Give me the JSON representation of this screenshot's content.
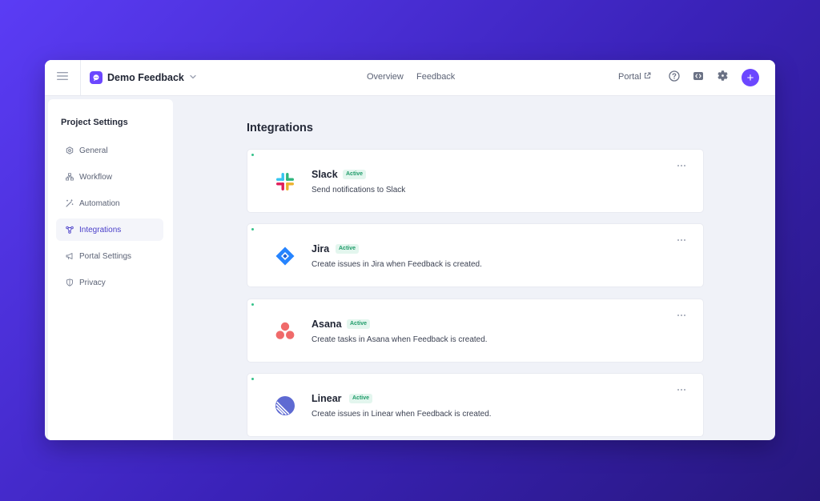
{
  "header": {
    "project_name": "Demo Feedback",
    "nav": [
      {
        "label": "Overview"
      },
      {
        "label": "Feedback"
      }
    ],
    "portal_label": "Portal",
    "icons": [
      "menu-icon",
      "chevron-down-icon",
      "external-link-icon",
      "help-icon",
      "code-icon",
      "gear-icon",
      "plus-icon"
    ],
    "plus_label": "+"
  },
  "sidebar": {
    "title": "Project Settings",
    "items": [
      {
        "label": "General",
        "icon": "settings-hex-icon"
      },
      {
        "label": "Workflow",
        "icon": "workflow-icon"
      },
      {
        "label": "Automation",
        "icon": "wand-icon"
      },
      {
        "label": "Integrations",
        "icon": "integrations-icon",
        "active": true
      },
      {
        "label": "Portal Settings",
        "icon": "megaphone-icon"
      },
      {
        "label": "Privacy",
        "icon": "shield-icon"
      }
    ]
  },
  "main": {
    "title": "Integrations",
    "integrations": [
      {
        "name": "Slack",
        "status": "Active",
        "description": "Send notifications to Slack",
        "icon": "slack-icon"
      },
      {
        "name": "Jira",
        "status": "Active",
        "description": "Create issues in Jira when Feedback is created.",
        "icon": "jira-icon"
      },
      {
        "name": "Asana",
        "status": "Active",
        "description": "Create tasks in Asana when Feedback is created.",
        "icon": "asana-icon"
      },
      {
        "name": "Linear",
        "status": "Active",
        "description": "Create issues in Linear when Feedback is created.",
        "icon": "linear-icon"
      }
    ]
  },
  "colors": {
    "accent": "#6c47ff",
    "active_badge_bg": "#e3f6ee",
    "active_badge_text": "#1f9b69",
    "background_gradient_start": "#5b3cf5",
    "background_gradient_end": "#27177e"
  }
}
